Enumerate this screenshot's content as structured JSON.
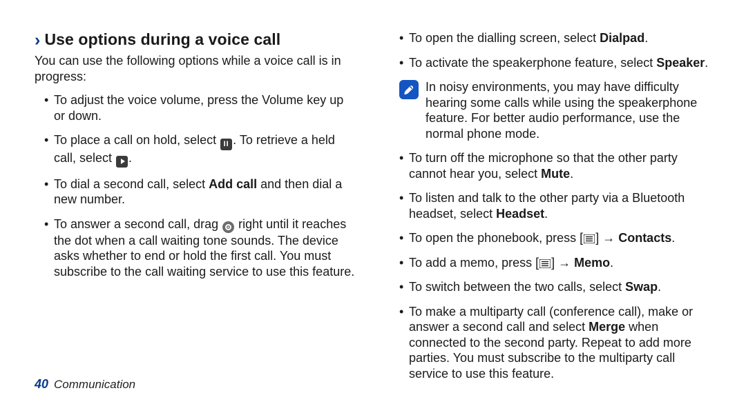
{
  "heading": "Use options during a voice call",
  "intro": "You can use the following options while a voice call is in progress:",
  "left_bullets": [
    {
      "parts": [
        {
          "t": "To adjust the voice volume, press the Volume key up or down."
        }
      ]
    },
    {
      "parts": [
        {
          "t": "To place a call on hold, select "
        },
        {
          "icon": "hold-icon"
        },
        {
          "t": ". To retrieve a held call, select "
        },
        {
          "icon": "resume-icon"
        },
        {
          "t": "."
        }
      ]
    },
    {
      "parts": [
        {
          "t": "To dial a second call, select "
        },
        {
          "b": "Add call"
        },
        {
          "t": " and then dial a new number."
        }
      ]
    },
    {
      "parts": [
        {
          "t": "To answer a second call, drag "
        },
        {
          "icon": "answer-icon"
        },
        {
          "t": " right until it reaches the dot when a call waiting tone sounds. The device asks whether to end or hold the first call. You must subscribe to the call waiting service to use this feature."
        }
      ]
    }
  ],
  "right_bullets_top": [
    {
      "parts": [
        {
          "t": "To open the dialling screen, select "
        },
        {
          "b": "Dialpad"
        },
        {
          "t": "."
        }
      ]
    },
    {
      "parts": [
        {
          "t": "To activate the speakerphone feature, select "
        },
        {
          "b": "Speaker"
        },
        {
          "t": "."
        }
      ]
    }
  ],
  "note": "In noisy environments, you may have difficulty hearing some calls while using the speakerphone feature. For better audio performance, use the normal phone mode.",
  "right_bullets_bottom": [
    {
      "parts": [
        {
          "t": "To turn off the microphone so that the other party cannot hear you, select "
        },
        {
          "b": "Mute"
        },
        {
          "t": "."
        }
      ]
    },
    {
      "parts": [
        {
          "t": "To listen and talk to the other party via a Bluetooth headset, select "
        },
        {
          "b": "Headset"
        },
        {
          "t": "."
        }
      ]
    },
    {
      "parts": [
        {
          "t": "To open the phonebook, press ["
        },
        {
          "icon": "menu-key-icon"
        },
        {
          "t": "] → "
        },
        {
          "b": "Contacts"
        },
        {
          "t": "."
        }
      ]
    },
    {
      "parts": [
        {
          "t": "To add a memo, press ["
        },
        {
          "icon": "menu-key-icon"
        },
        {
          "t": "] → "
        },
        {
          "b": "Memo"
        },
        {
          "t": "."
        }
      ]
    },
    {
      "parts": [
        {
          "t": "To switch between the two calls, select "
        },
        {
          "b": "Swap"
        },
        {
          "t": "."
        }
      ]
    },
    {
      "parts": [
        {
          "t": "To make a multiparty call (conference call), make or answer a second call and select "
        },
        {
          "b": "Merge"
        },
        {
          "t": " when connected to the second party. Repeat to add more parties. You must subscribe to the multiparty call service to use this feature."
        }
      ]
    }
  ],
  "footer": {
    "page": "40",
    "section": "Communication"
  }
}
